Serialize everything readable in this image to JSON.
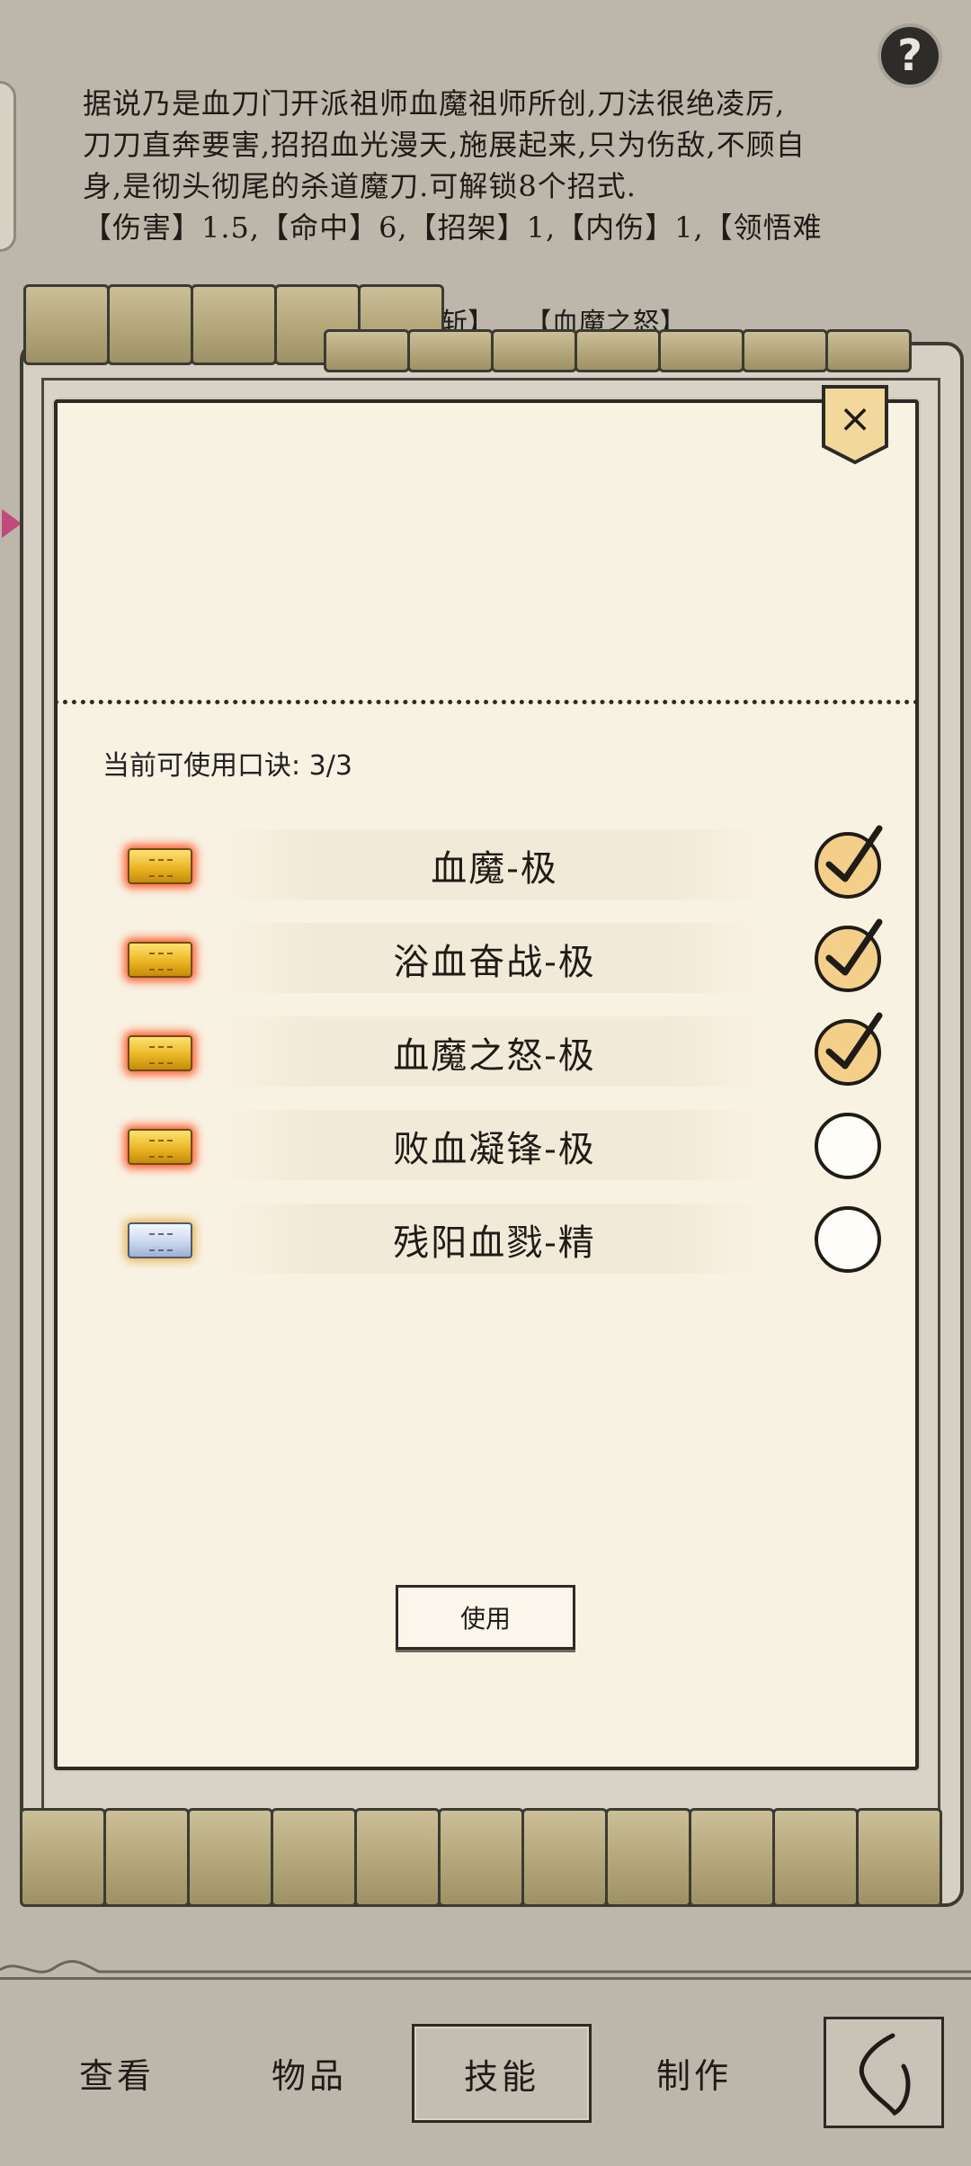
{
  "description": {
    "lines": [
      "据说乃是血刀门开派祖师血魔祖师所创,刀法很绝凌厉,",
      "刀刀直奔要害,招招血光漫天,施展起来,只为伤敌,不顾自",
      "身,是彻头彻尾的杀道魔刀.可解锁8个招式.",
      "【伤害】1.5,【命中】6,【招架】1,【内伤】1,【领悟难"
    ],
    "move_tags": [
      "【血魔斩】",
      "【血魔之怒】"
    ]
  },
  "help_label": "?",
  "modal": {
    "close_label": "×",
    "count_label": "当前可使用口诀: 3/3",
    "items": [
      {
        "name": "血魔-极",
        "type": "gold",
        "checked": true
      },
      {
        "name": "浴血奋战-极",
        "type": "gold",
        "checked": true
      },
      {
        "name": "血魔之怒-极",
        "type": "gold",
        "checked": true
      },
      {
        "name": "败血凝锋-极",
        "type": "gold",
        "checked": false
      },
      {
        "name": "残阳血戮-精",
        "type": "silver",
        "checked": false
      }
    ],
    "use_label": "使用"
  },
  "nav": {
    "items": [
      "查看",
      "物品",
      "技能",
      "制作"
    ],
    "active": "技能"
  },
  "colors": {
    "background": "#bdb7ab",
    "paper": "#f8f2e3",
    "check_fill": "#f4cf8a",
    "gold_glow": "#ff5a2c"
  }
}
